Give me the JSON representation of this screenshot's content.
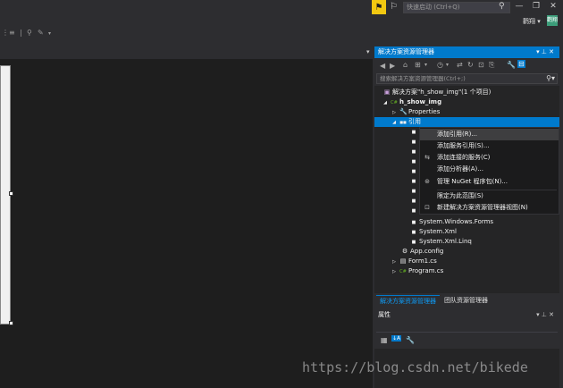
{
  "titlebar": {
    "notification_icon": "flag-icon",
    "feedback_icon": "feedback-icon",
    "quick_launch_placeholder": "快速启动 (Ctrl+Q)",
    "search_icon": "search-icon",
    "minimize": "—",
    "restore": "❐",
    "close": "✕",
    "user_name": "鹳翔",
    "user_dropdown": "▾",
    "avatar_text": "鹳翔"
  },
  "toolbar": {
    "items": [
      "⋮≡",
      "|",
      "⚲",
      "✎",
      "▾"
    ]
  },
  "editor": {
    "dropdown": "▾"
  },
  "solution_explorer": {
    "title": "解决方案资源管理器",
    "title_buttons": "▾ ⊥ ✕",
    "toolbar_glyphs": [
      "◀",
      "▶",
      "⌂",
      "⊞",
      "▾",
      "◷",
      "▾",
      "⇄",
      "↻",
      "⊡",
      "⎘",
      "🔧",
      "⊟"
    ],
    "search_placeholder": "搜索解决方案资源管理器(Ctrl+;)",
    "search_icon": "⚲▾",
    "tree": [
      {
        "label": "解决方案\"h_show_img\"(1 个项目)",
        "icon": "▣",
        "expander": "",
        "bold": false
      },
      {
        "label": "h_show_img",
        "icon": "C#",
        "expander": "◢",
        "bold": true
      },
      {
        "label": "Properties",
        "icon": "🔧",
        "expander": "▷",
        "bold": false
      },
      {
        "label": "引用",
        "icon": "■■",
        "expander": "◢",
        "bold": false,
        "selected": true
      },
      {
        "label": "System.Windows.Forms",
        "icon": "■",
        "expander": "",
        "bold": false
      },
      {
        "label": "System.Xml",
        "icon": "■",
        "expander": "",
        "bold": false
      },
      {
        "label": "System.Xml.Linq",
        "icon": "■",
        "expander": "",
        "bold": false
      },
      {
        "label": "App.config",
        "icon": "⚙",
        "expander": "",
        "bold": false
      },
      {
        "label": "Form1.cs",
        "icon": "▤",
        "expander": "▷",
        "bold": false
      },
      {
        "label": "Program.cs",
        "icon": "C#",
        "expander": "▷",
        "bold": false
      }
    ],
    "context_menu": [
      {
        "label": "添加引用(R)...",
        "icon": "",
        "highlighted": true
      },
      {
        "label": "添加服务引用(S)...",
        "icon": ""
      },
      {
        "label": "添加连接的服务(C)",
        "icon": "⇆"
      },
      {
        "label": "添加分析器(A)...",
        "icon": ""
      },
      {
        "label": "管理 NuGet 程序包(N)...",
        "icon": "⊛"
      },
      {
        "label": "限定为此范围(S)",
        "icon": ""
      },
      {
        "label": "新建解决方案资源管理器视图(N)",
        "icon": "⊡"
      }
    ]
  },
  "bottom_tabs": [
    {
      "label": "解决方案资源管理器",
      "active": true
    },
    {
      "label": "团队资源管理器",
      "active": false
    }
  ],
  "properties": {
    "title": "属性",
    "title_buttons": "▾ ⊥ ✕",
    "toolbar_glyphs": [
      "▦",
      "↓A",
      "🔧"
    ]
  },
  "watermark": "https://blog.csdn.net/bikede"
}
